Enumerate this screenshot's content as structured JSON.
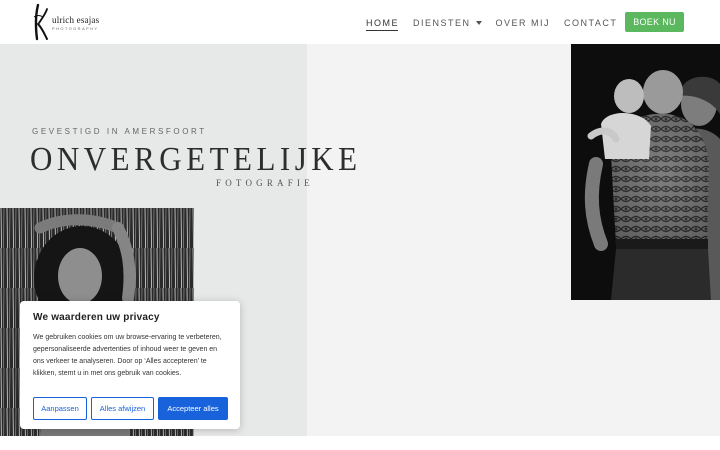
{
  "header": {
    "logo": {
      "name": "ulrich esajas",
      "sub": "PHOTOGRAPHY"
    },
    "nav": [
      {
        "label": "HOME",
        "active": true
      },
      {
        "label": "DIENSTEN",
        "dropdown": true
      },
      {
        "label": "OVER MIJ"
      },
      {
        "label": "CONTACT"
      }
    ],
    "cta_label": "BOEK NU"
  },
  "hero": {
    "kicker": "GEVESTIGD IN AMERSFOORT",
    "title": "ONVERGETELIJKE",
    "subtitle": "FOTOGRAFIE"
  },
  "cookie": {
    "title": "We waarderen uw privacy",
    "text": "We gebruiken cookies om uw browse-ervaring te verbeteren, gepersonaliseerde advertenties of inhoud weer te geven en ons verkeer te analyseren. Door op ‘Alles accepteren’ te klikken, stemt u in met ons gebruik van cookies.",
    "customize_label": "Aanpassen",
    "reject_label": "Alles afwijzen",
    "accept_label": "Accepteer alles"
  },
  "colors": {
    "cta_green": "#5bb85e",
    "cookie_blue": "#1863dc",
    "hero_left_bg": "#e7e9e8",
    "hero_right_bg": "#f3f3f3"
  },
  "icons": {
    "logo": "uk-monogram",
    "dropdown": "caret-down-icon"
  }
}
